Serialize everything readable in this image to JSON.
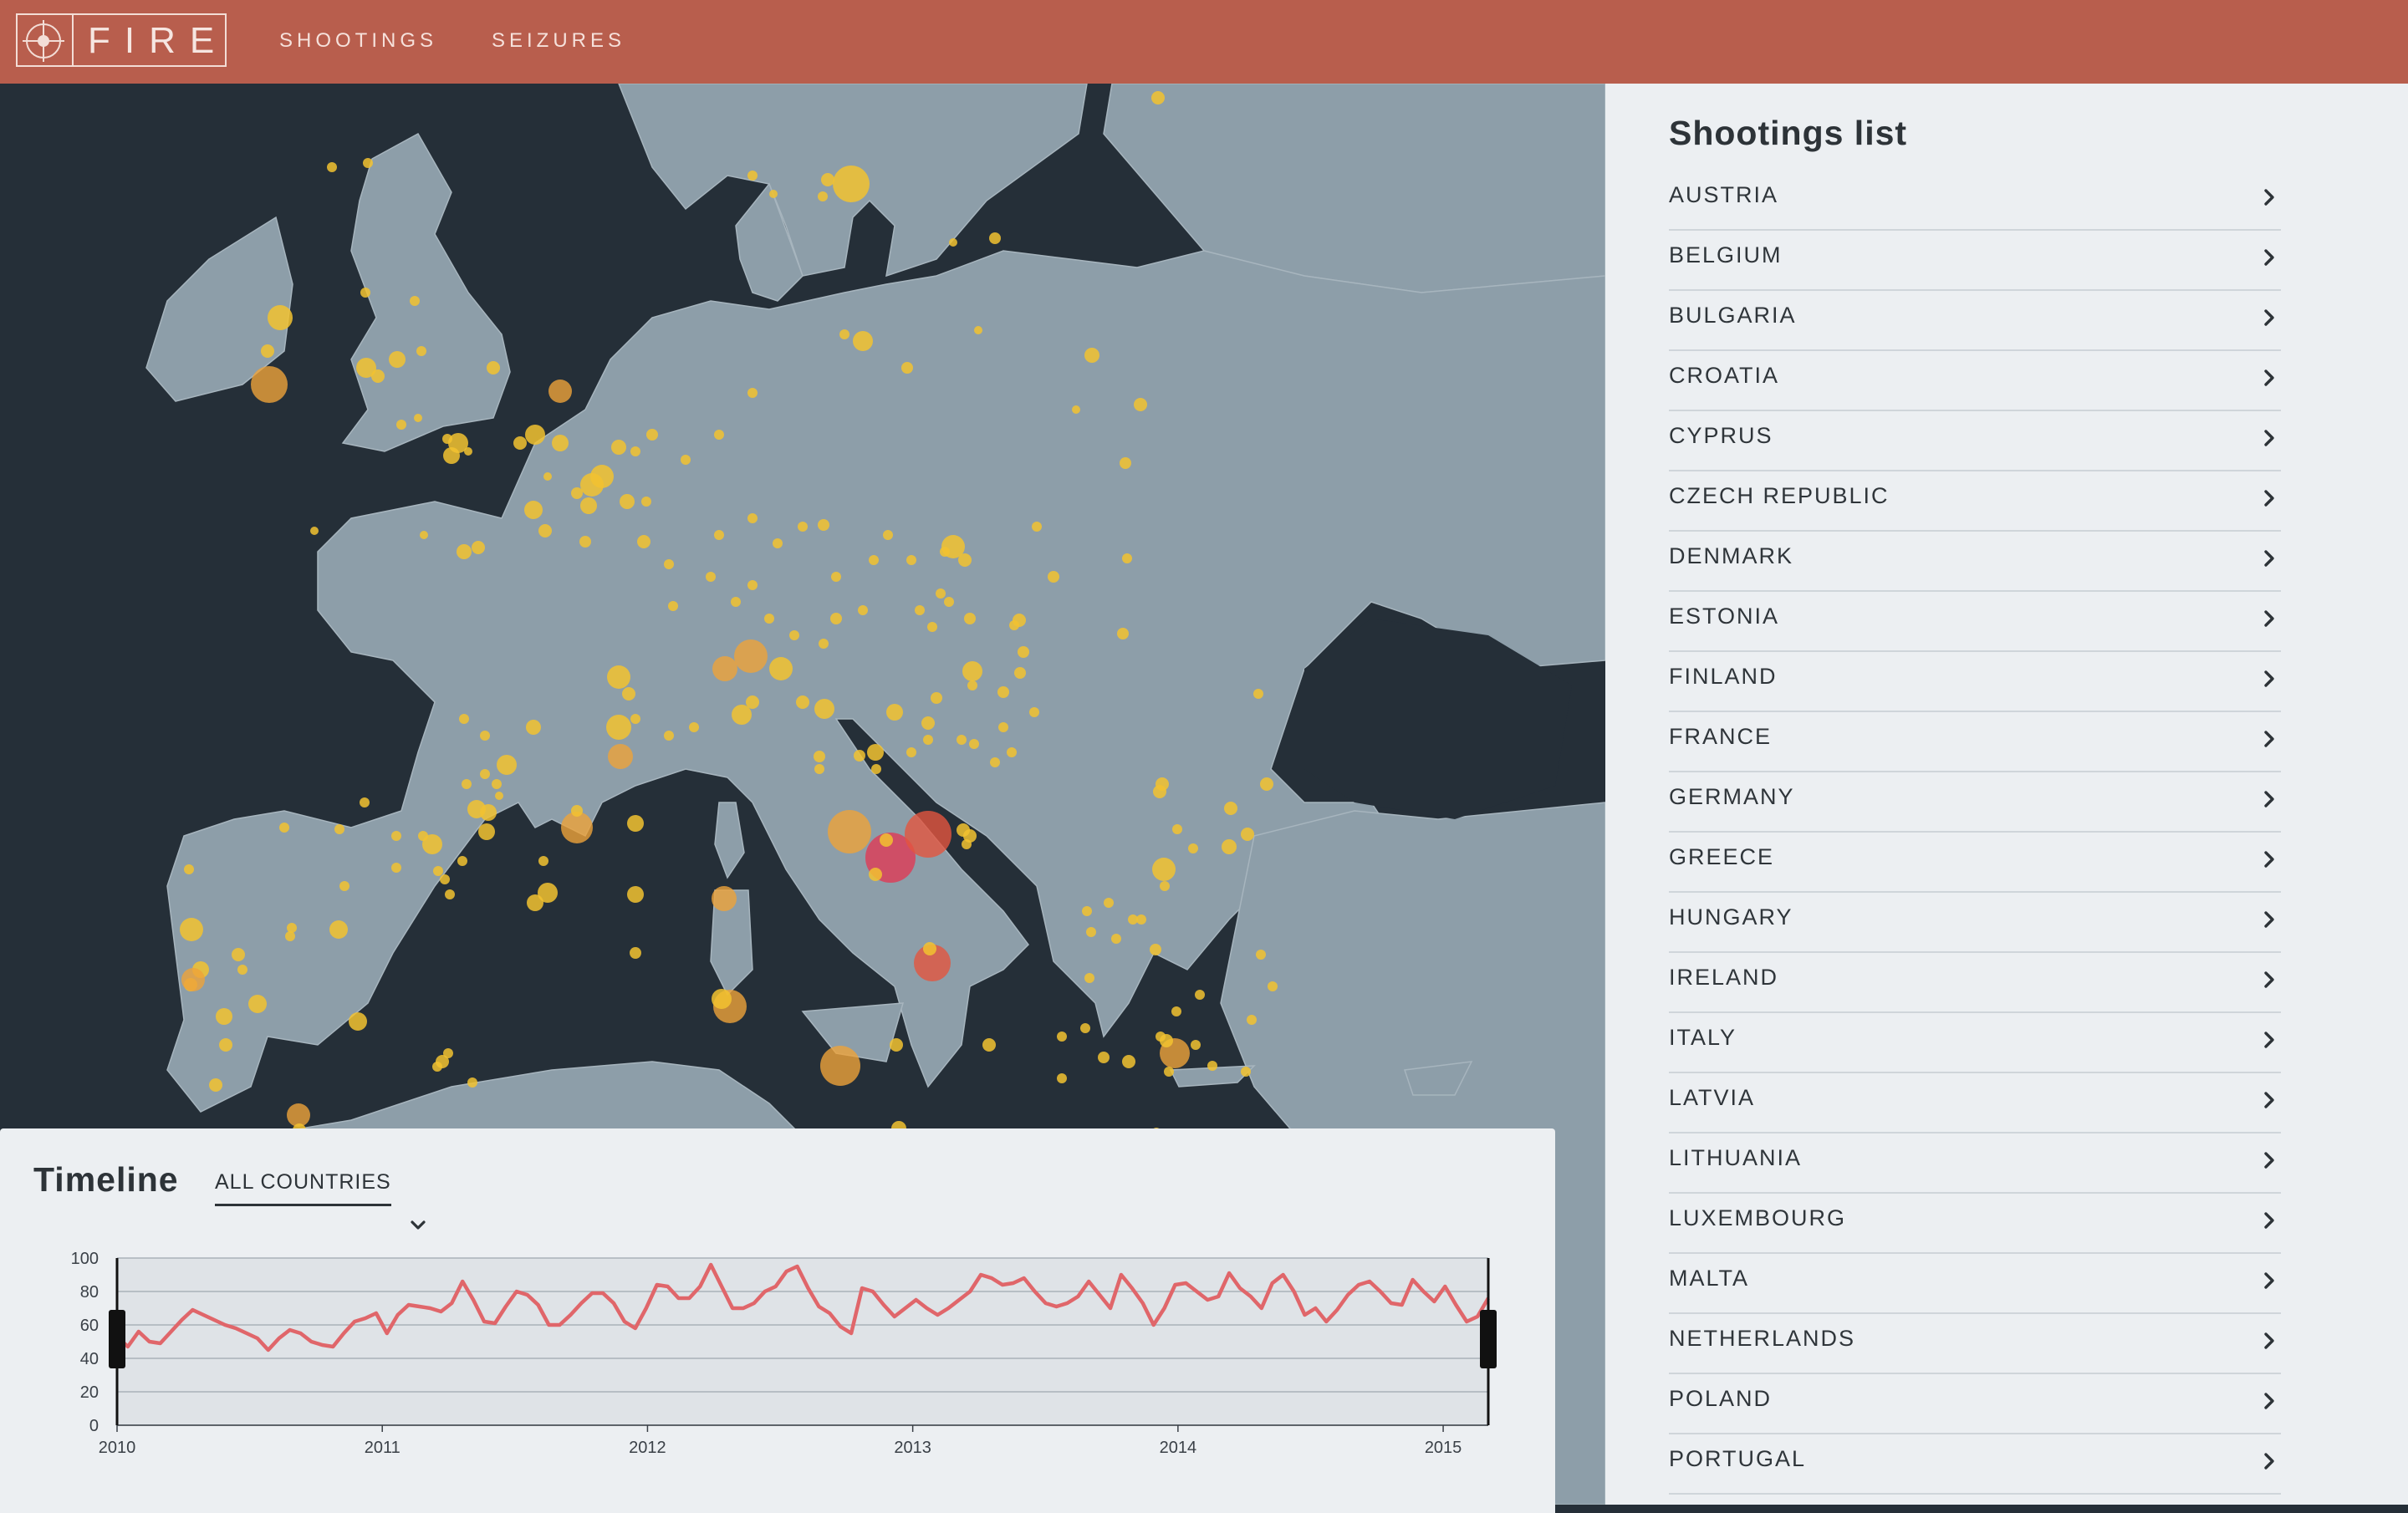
{
  "header": {
    "logo_text": "FIRE",
    "nav": [
      {
        "label": "SHOOTINGS"
      },
      {
        "label": "SEIZURES"
      }
    ],
    "color": "#b85e4d"
  },
  "sidebar": {
    "title": "Shootings list",
    "countries": [
      "AUSTRIA",
      "BELGIUM",
      "BULGARIA",
      "CROATIA",
      "CYPRUS",
      "CZECH REPUBLIC",
      "DENMARK",
      "ESTONIA",
      "FINLAND",
      "FRANCE",
      "GERMANY",
      "GREECE",
      "HUNGARY",
      "IRELAND",
      "ITALY",
      "LATVIA",
      "LITHUANIA",
      "LUXEMBOURG",
      "MALTA",
      "NETHERLANDS",
      "POLAND",
      "PORTUGAL"
    ]
  },
  "timeline": {
    "title": "Timeline",
    "selected_country": "ALL COUNTRIES"
  },
  "colors": {
    "land": "#8d9ea9",
    "sea": "#252f38",
    "marker_small": "#f2c230",
    "marker_mid": "#eea23a",
    "marker_large": "#e3553f",
    "marker_max": "#e03a55",
    "line": "#e0666a"
  },
  "chart_data": {
    "type": "line",
    "title": "",
    "xlabel": "",
    "ylabel": "",
    "x_ticks": [
      "2010",
      "2011",
      "2012",
      "2013",
      "2014",
      "2015"
    ],
    "y_ticks": [
      0,
      20,
      40,
      60,
      80,
      100
    ],
    "ylim": [
      0,
      100
    ],
    "xlim": [
      2010,
      2015.17
    ],
    "grid": true,
    "series": [
      {
        "values": [
          53,
          47,
          56,
          50,
          49,
          56,
          63,
          69,
          66,
          63,
          60,
          58,
          55,
          52,
          45,
          52,
          57,
          55,
          50,
          48,
          47,
          55,
          62,
          64,
          67,
          55,
          66,
          72,
          71,
          70,
          68,
          73,
          86,
          75,
          62,
          61,
          71,
          80,
          78,
          72,
          60,
          60,
          66,
          73,
          79,
          79,
          73,
          62,
          58,
          70,
          84,
          83,
          76,
          76,
          83,
          96,
          83,
          70,
          70,
          73,
          80,
          83,
          92,
          95,
          82,
          71,
          67,
          59,
          55,
          82,
          80,
          72,
          65,
          70,
          75,
          70,
          66,
          70,
          75,
          80,
          90,
          88,
          84,
          85,
          88,
          80,
          73,
          71,
          73,
          77,
          86,
          78,
          70,
          90,
          82,
          73,
          60,
          70,
          84,
          85,
          80,
          75,
          77,
          91,
          82,
          77,
          70,
          85,
          90,
          80,
          66,
          70,
          62,
          69,
          78,
          84,
          86,
          80,
          73,
          72,
          87,
          80,
          74,
          83,
          72,
          62,
          65,
          76
        ],
        "x_start": 2010,
        "x_end": 2015.17
      }
    ]
  }
}
